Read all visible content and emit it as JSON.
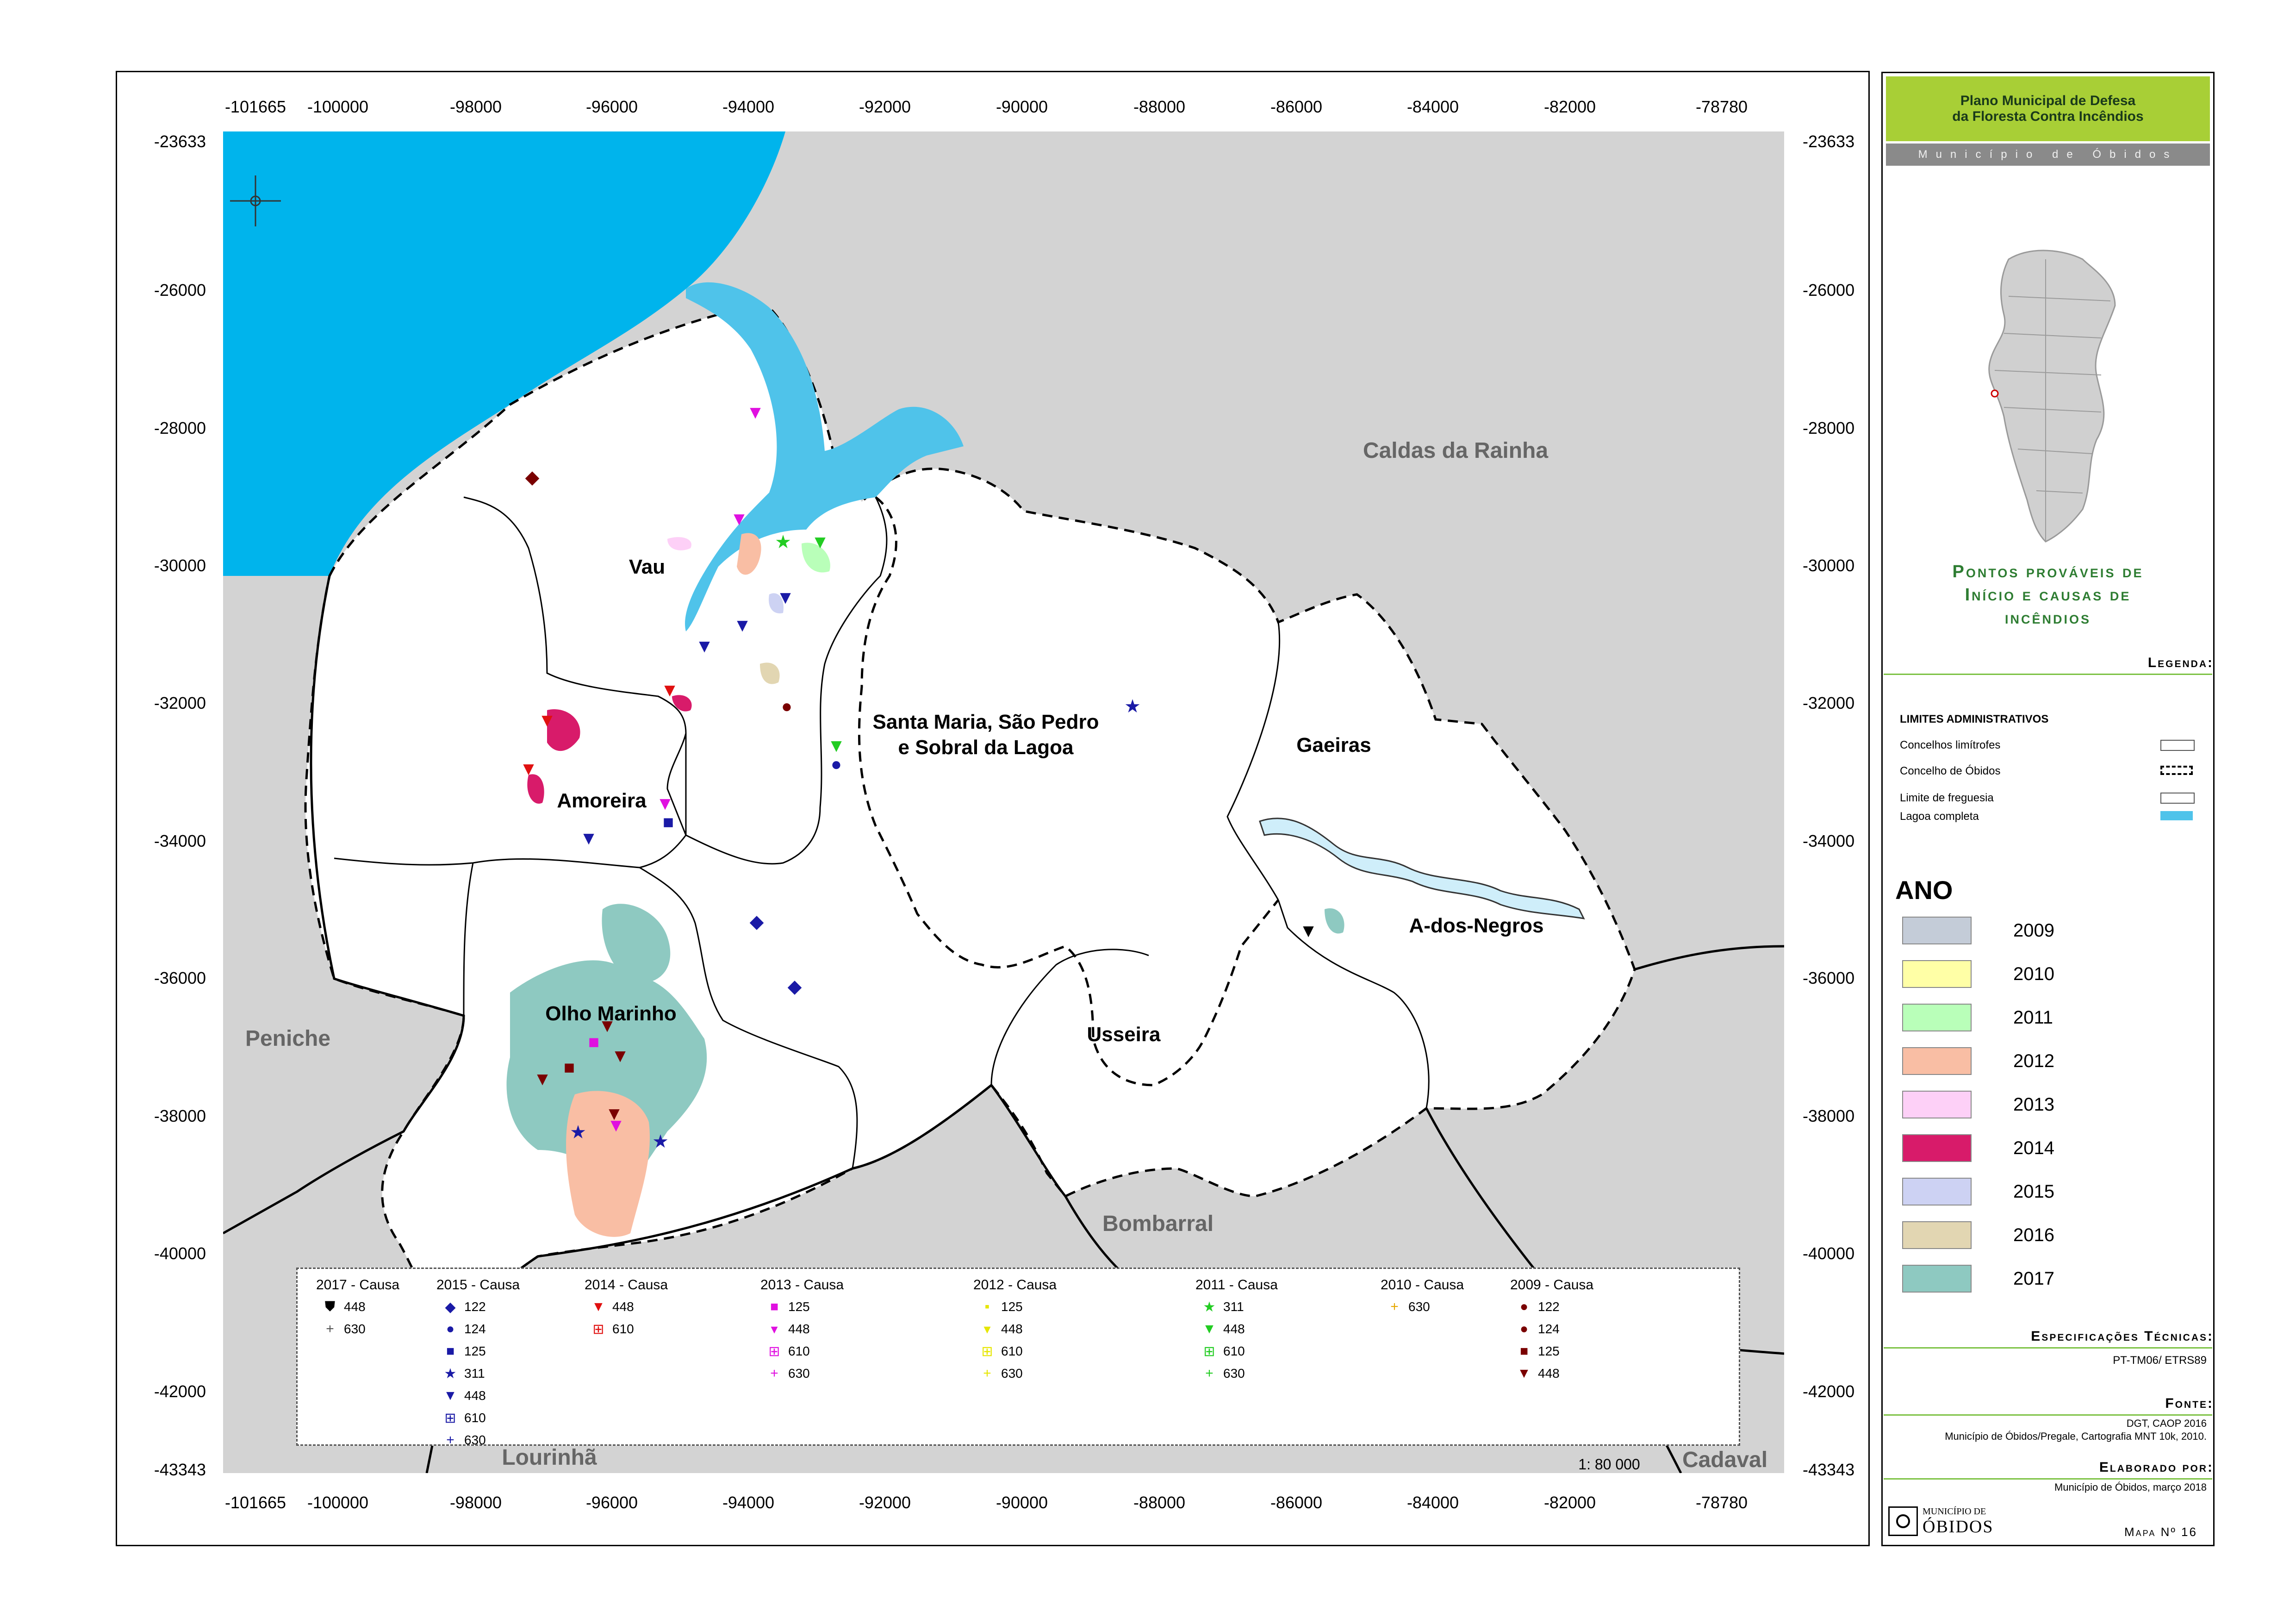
{
  "map": {
    "x_ticks": [
      "-101665",
      "-100000",
      "-98000",
      "-96000",
      "-94000",
      "-92000",
      "-90000",
      "-88000",
      "-86000",
      "-84000",
      "-82000",
      "-78780"
    ],
    "y_ticks": [
      "-23633",
      "-26000",
      "-28000",
      "-30000",
      "-32000",
      "-34000",
      "-36000",
      "-38000",
      "-40000",
      "-42000",
      "-43343"
    ],
    "places": {
      "caldas": "Caldas da Rainha",
      "vau": "Vau",
      "santa_maria_1": "Santa Maria, São Pedro",
      "santa_maria_2": "e Sobral da Lagoa",
      "gaeiras": "Gaeiras",
      "amoreira": "Amoreira",
      "a_dos_negros": "A-dos-Negros",
      "olho_marinho": "Olho Marinho",
      "usseira": "Usseira",
      "peniche": "Peniche",
      "bombarral": "Bombarral",
      "lourinha": "Lourinhã",
      "cadaval": "Cadaval"
    },
    "scale": "1: 80 000",
    "colors": {
      "sea": "#00b4ec",
      "lagoon": "#4fc3ea",
      "outside": "#d3d3d3",
      "municipality": "#ffffff",
      "river": "#cfeefa"
    }
  },
  "fire_legend": {
    "col_2017": {
      "title": "2017 - Causa",
      "items": [
        {
          "sym": "⛊",
          "code": "448",
          "color": "#000000"
        },
        {
          "sym": "+",
          "code": "630",
          "color": "#555555"
        }
      ]
    },
    "col_2015": {
      "title": "2015 - Causa",
      "items": [
        {
          "sym": "◆",
          "code": "122",
          "color": "#1a1aa6"
        },
        {
          "sym": "●",
          "code": "124",
          "color": "#1a1aa6"
        },
        {
          "sym": "■",
          "code": "125",
          "color": "#1a1aa6"
        },
        {
          "sym": "★",
          "code": "311",
          "color": "#1a1aa6"
        },
        {
          "sym": "▼",
          "code": "448",
          "color": "#1a1aa6"
        },
        {
          "sym": "⊞",
          "code": "610",
          "color": "#1a1aa6"
        },
        {
          "sym": "+",
          "code": "630",
          "color": "#1a1aa6"
        }
      ]
    },
    "col_2014": {
      "title": "2014 -  Causa",
      "items": [
        {
          "sym": "▼",
          "code": "448",
          "color": "#e01010"
        },
        {
          "sym": "⊞",
          "code": "610",
          "color": "#e01010"
        }
      ]
    },
    "col_2013": {
      "title": "2013 -  Causa",
      "items": [
        {
          "sym": "■",
          "code": "125",
          "color": "#e010e0"
        },
        {
          "sym": "▾",
          "code": "448",
          "color": "#e010e0"
        },
        {
          "sym": "⊞",
          "code": "610",
          "color": "#e010e0"
        },
        {
          "sym": "+",
          "code": "630",
          "color": "#e010e0"
        }
      ]
    },
    "col_2012": {
      "title": "2012 -  Causa",
      "items": [
        {
          "sym": "▪",
          "code": "125",
          "color": "#e6e600"
        },
        {
          "sym": "▾",
          "code": "448",
          "color": "#e6e600"
        },
        {
          "sym": "⊞",
          "code": "610",
          "color": "#e6e600"
        },
        {
          "sym": "+",
          "code": "630",
          "color": "#e6e600"
        }
      ]
    },
    "col_2011": {
      "title": "2011 - Causa",
      "items": [
        {
          "sym": "★",
          "code": "311",
          "color": "#22cc22"
        },
        {
          "sym": "▼",
          "code": "448",
          "color": "#22cc22"
        },
        {
          "sym": "⊞",
          "code": "610",
          "color": "#22cc22"
        },
        {
          "sym": "+",
          "code": "630",
          "color": "#22cc22"
        }
      ]
    },
    "col_2010": {
      "title": "2010 - Causa",
      "items": [
        {
          "sym": "+",
          "code": "630",
          "color": "#e6a800"
        }
      ]
    },
    "col_2009": {
      "title": "2009 - Causa",
      "items": [
        {
          "sym": "●",
          "code": "122",
          "color": "#7a0000"
        },
        {
          "sym": "●",
          "code": "124",
          "color": "#7a0000"
        },
        {
          "sym": "■",
          "code": "125",
          "color": "#7a0000"
        },
        {
          "sym": "▼",
          "code": "448",
          "color": "#7a0000"
        }
      ]
    }
  },
  "panel": {
    "header_line1": "Plano Municipal de Defesa",
    "header_line2": "da Floresta Contra Incêndios",
    "municipality": "Município de Óbidos",
    "map_title_line1": "Pontos prováveis de",
    "map_title_line2": "Início e causas de",
    "map_title_line3": "incêndios",
    "legend_label": "Legenda:",
    "admin_title": "LIMITES ADMINISTRATIVOS",
    "admin_items": [
      "Concelhos limítrofes",
      "Concelho de Óbidos",
      "Limite de freguesia",
      "Lagoa completa"
    ],
    "ano_title": "ANO",
    "years": [
      {
        "label": "2009",
        "color": "#c4ccd8"
      },
      {
        "label": "2010",
        "color": "#ffffa6"
      },
      {
        "label": "2011",
        "color": "#b9ffb9"
      },
      {
        "label": "2012",
        "color": "#f9bea4"
      },
      {
        "label": "2013",
        "color": "#fdd0f7"
      },
      {
        "label": "2014",
        "color": "#d81b6a"
      },
      {
        "label": "2015",
        "color": "#cdd2f3"
      },
      {
        "label": "2016",
        "color": "#e2d6b2"
      },
      {
        "label": "2017",
        "color": "#8ec9c1"
      }
    ],
    "spec_label": "Especificações Técnicas:",
    "spec_value": "PT-TM06/ ETRS89",
    "source_label": "Fonte:",
    "source_line1": "DGT, CAOP 2016",
    "source_line2": "Município de Óbidos/Pregale, Cartografia MNT 10k, 2010.",
    "author_label": "Elaborado por:",
    "author_value": "Município de Óbidos, março 2018",
    "logo_text1": "MUNICÍPIO DE",
    "logo_text2": "ÓBIDOS",
    "map_number": "Mapa Nº 16"
  }
}
